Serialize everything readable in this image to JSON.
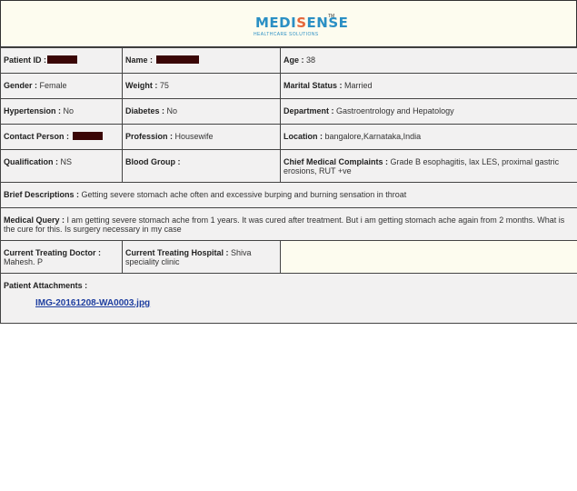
{
  "logo": {
    "brand_left": "MEDI",
    "brand_right": "ENSE",
    "brand_mid": "S",
    "tagline": "HEALTHCARE SOLUTIONS",
    "tm": "TM",
    "colors": {
      "blue": "#2a8fc4",
      "orange": "#e5673b"
    }
  },
  "fields": {
    "patient_id_label": "Patient ID :",
    "name_label": "Name :",
    "age_label": "Age :",
    "age_value": "38",
    "gender_label": "Gender :",
    "gender_value": "Female",
    "weight_label": "Weight :",
    "weight_value": "75",
    "marital_label": "Marital Status :",
    "marital_value": "Married",
    "hypertension_label": "Hypertension :",
    "hypertension_value": "No",
    "diabetes_label": "Diabetes :",
    "diabetes_value": "No",
    "department_label": "Department :",
    "department_value": "Gastroentrology and Hepatology",
    "contact_label": "Contact Person :",
    "profession_label": "Profession :",
    "profession_value": "Housewife",
    "location_label": "Location :",
    "location_value": "bangalore,Karnataka,India",
    "qualification_label": "Qualification :",
    "qualification_value": "NS",
    "blood_label": "Blood Group :",
    "blood_value": "",
    "complaints_label": "Chief Medical Complaints :",
    "complaints_value": "Grade B esophagitis, lax LES, proximal gastric erosions, RUT +ve",
    "brief_label": "Brief Descriptions :",
    "brief_value": "Getting severe stomach ache often and excessive burping and burning sensation in throat",
    "query_label": "Medical Query :",
    "query_value": "I am getting severe stomach ache from 1 years. It was cured after treatment. But i am getting stomach ache again from 2 months. What is the cure for this. Is surgery necessary in my case",
    "doctor_label": "Current Treating Doctor :",
    "doctor_value": "Mahesh. P",
    "hospital_label": "Current Treating Hospital :",
    "hospital_value": "Shiva speciality clinic",
    "attachments_label": "Patient Attachments :",
    "attachment_file": "IMG-20161208-WA0003.jpg"
  },
  "redaction_color": "#3a0606"
}
